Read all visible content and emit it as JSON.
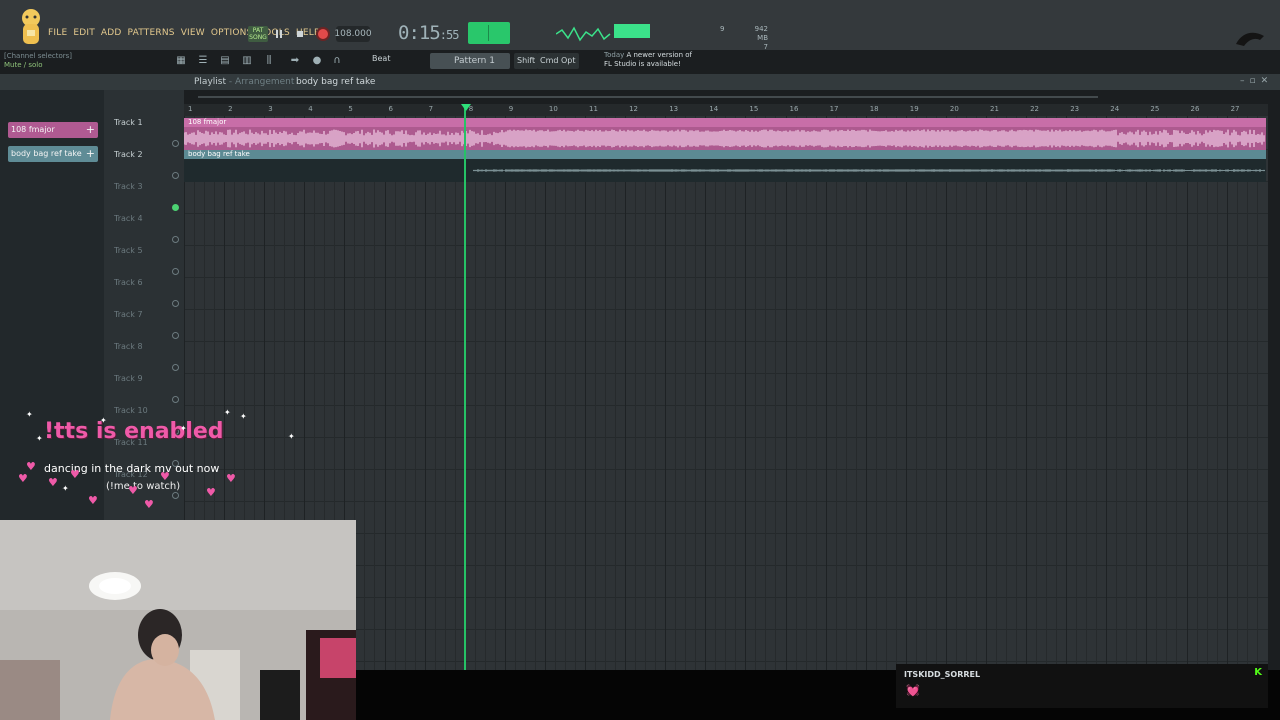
{
  "menu": [
    "FILE",
    "EDIT",
    "ADD",
    "PATTERNS",
    "VIEW",
    "OPTIONS",
    "TOOLS",
    "HELP"
  ],
  "hint": {
    "line1": "[Channel selectors]",
    "line2": "Mute / solo"
  },
  "transport": {
    "mode_top": "PAT",
    "mode_bottom": "SONG",
    "play_icon": "pause-icon",
    "tempo": "108.000",
    "time_main": "0:15",
    "time_sub": ":55"
  },
  "memory": {
    "left_top": "9",
    "left_bottom": "",
    "right_top": "942 MB",
    "right_bottom": "7"
  },
  "toolbar": {
    "snap": "Beat",
    "pattern": "Pattern 1",
    "shift": "Shift",
    "cmd": "Cmd",
    "opt": "Opt",
    "news_line1_a": "Today",
    "news_line1_b": "A newer version of",
    "news_line2": "FL Studio is available!"
  },
  "playlist": {
    "title": "Playlist",
    "subtitle": "- Arrangement",
    "pattern": "body bag ref take",
    "tracks": [
      "Track 1",
      "Track 2",
      "Track 3",
      "Track 4",
      "Track 5",
      "Track 6",
      "Track 7",
      "Track 8",
      "Track 9",
      "Track 10",
      "Track 11",
      "Track 12"
    ],
    "bars": [
      "1",
      "2",
      "3",
      "4",
      "5",
      "6",
      "7",
      "8",
      "9",
      "10",
      "11",
      "12",
      "13",
      "14",
      "15",
      "16",
      "17",
      "18",
      "19",
      "20",
      "21",
      "22",
      "23",
      "24",
      "25",
      "26",
      "27"
    ],
    "picker_clips": [
      "108 fmajor",
      "body bag ref take"
    ],
    "clips": [
      {
        "name": "108 fmajor",
        "track": 1
      },
      {
        "name": "body bag ref take",
        "track": 2
      }
    ]
  },
  "overlay": {
    "tts": "!tts is enabled",
    "mv": "dancing in the dark mv out now",
    "watch": "(!me to watch)"
  },
  "chat": {
    "user": "ITSKIDD_SORREL",
    "message": "💓",
    "badge": "K"
  },
  "colors": {
    "accent_green": "#29c76b",
    "clip_pink": "#ad5a8f",
    "clip_teal": "#5c8a93",
    "overlay_pink": "#ef5aa8"
  }
}
